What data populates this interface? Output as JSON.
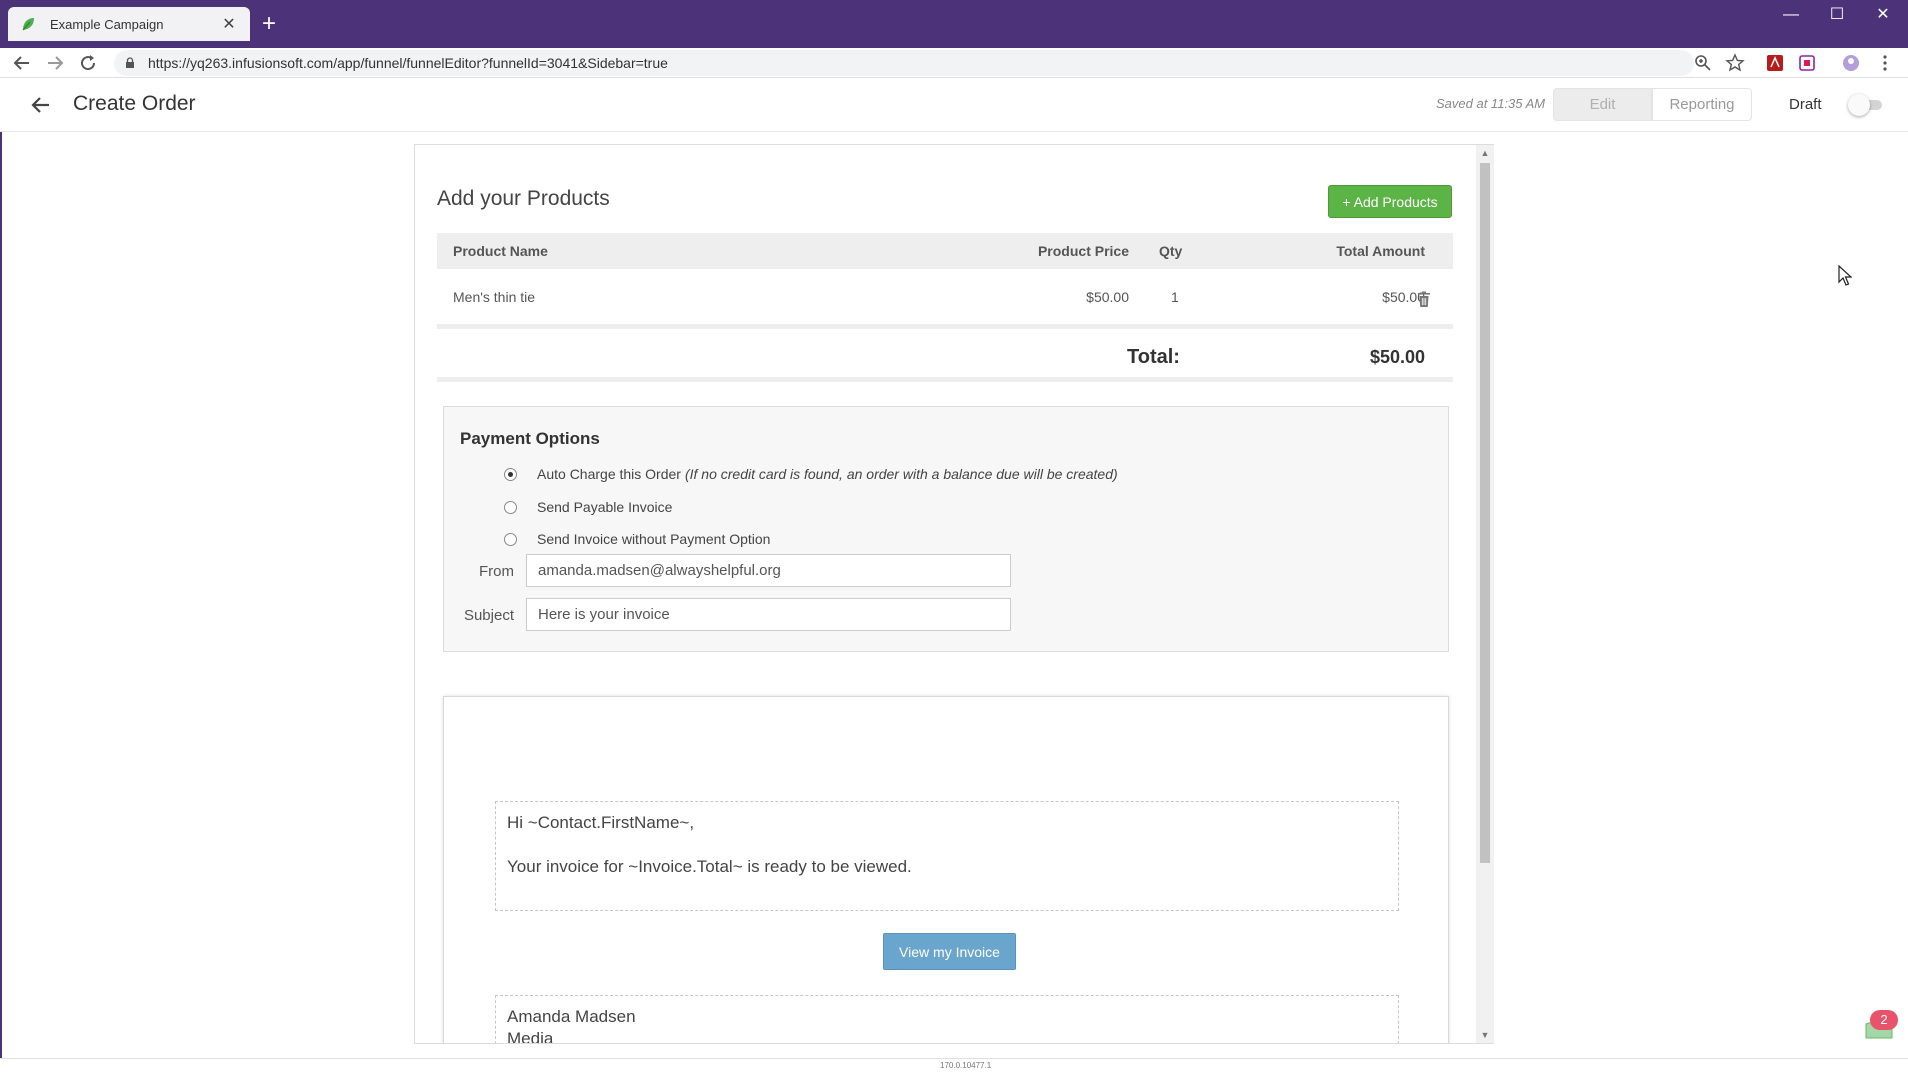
{
  "browser": {
    "tab_title": "Example Campaign",
    "tab_close": "✕",
    "new_tab": "+",
    "url": "https://yq263.infusionsoft.com/app/funnel/funnelEditor?funnelId=3041&Sidebar=true",
    "window_controls": {
      "minimize": "—",
      "maximize": "☐",
      "close": "✕"
    }
  },
  "header": {
    "title": "Create Order",
    "saved_text": "Saved at 11:35 AM",
    "tabs": {
      "edit": "Edit",
      "reporting": "Reporting"
    },
    "draft_label": "Draft",
    "draft_on": false
  },
  "products": {
    "title": "Add your Products",
    "add_button": "+ Add Products",
    "columns": {
      "name": "Product Name",
      "price": "Product Price",
      "qty": "Qty",
      "total": "Total Amount"
    },
    "rows": [
      {
        "name": "Men's thin tie",
        "price": "$50.00",
        "qty": "1",
        "total": "$50.00"
      }
    ],
    "total_label": "Total:",
    "total_value": "$50.00"
  },
  "payment": {
    "title": "Payment Options",
    "options": [
      {
        "label": "Auto Charge this Order",
        "note": "(If no credit card is found, an order with a balance due will be created)",
        "checked": true
      },
      {
        "label": "Send Payable Invoice",
        "note": "",
        "checked": false
      },
      {
        "label": "Send Invoice without Payment Option",
        "note": "",
        "checked": false
      }
    ],
    "from_label": "From",
    "from_value": "amanda.madsen@alwayshelpful.org",
    "subject_label": "Subject",
    "subject_value": "Here is your invoice"
  },
  "email": {
    "greeting": "Hi ~Contact.FirstName~,",
    "body": "Your invoice for ~Invoice.Total~ is ready to be viewed.",
    "button": "View my Invoice",
    "signature_name": "Amanda Madsen",
    "signature_company": "Media"
  },
  "chat": {
    "badge_count": "2"
  },
  "status_bar": {
    "text": "170.0.10477.1"
  },
  "colors": {
    "browser_frame": "#4b3279",
    "add_button": "#5cb346",
    "view_invoice_button": "#6aa5ce",
    "chat_badge": "#e8536b"
  },
  "icons": {
    "favicon": "leaf-icon",
    "back": "arrow-left-icon",
    "forward": "arrow-right-icon",
    "reload": "reload-icon",
    "lock": "lock-icon",
    "zoom": "zoom-icon",
    "bookmark": "star-icon",
    "trash": "trash-icon"
  }
}
